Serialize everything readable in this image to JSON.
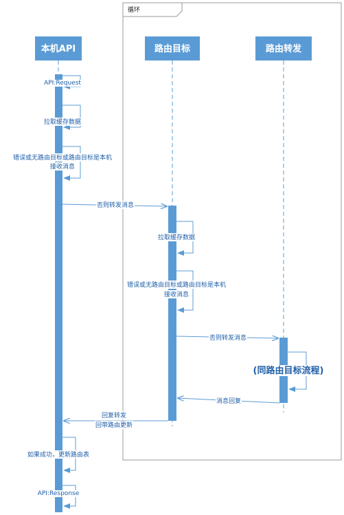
{
  "frame": {
    "title": "循环"
  },
  "participants": [
    {
      "id": "local",
      "label": "本机API"
    },
    {
      "id": "target",
      "label": "路由目标"
    },
    {
      "id": "forward",
      "label": "路由转发"
    }
  ],
  "messages": {
    "api_request": "API:Request",
    "pull_cache_1": "拉取缓存数据",
    "error_1_line1": "错误或无路由目标或路由目标是本机",
    "error_1_line2": "接收消息",
    "else_forward_1": "否则转发消息",
    "pull_cache_2": "拉取缓存数据",
    "error_2_line1": "错误或无路由目标或路由目标是本机",
    "error_2_line2": "接收消息",
    "else_forward_2": "否则转发消息",
    "same_flow": "(同路由目标流程)",
    "msg_reply": "消息回复",
    "reply_forward_line1": "回复转发",
    "reply_forward_line2": "回带路由更新",
    "update_route": "如果成功，更新路由表",
    "api_response": "API:Response"
  },
  "colors": {
    "accent": "#5b9bd5",
    "text": "#1f5fa8",
    "frame": "#9a9a9a"
  }
}
